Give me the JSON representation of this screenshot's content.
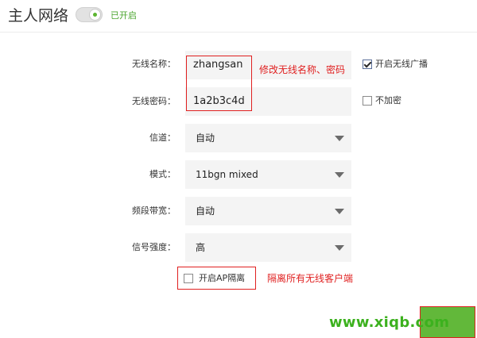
{
  "header": {
    "title": "主人网络",
    "toggle_status": "已开启"
  },
  "wireless": {
    "ssid_label": "无线名称：",
    "ssid_value": "zhangsan",
    "password_label": "无线密码：",
    "password_value": "1a2b3c4d",
    "broadcast_label": "开启无线广播",
    "broadcast_checked": true,
    "no_encrypt_label": "不加密",
    "no_encrypt_checked": false
  },
  "settings": {
    "channel_label": "信道：",
    "channel_value": "自动",
    "mode_label": "模式：",
    "mode_value": "11bgn mixed",
    "bandwidth_label": "频段带宽：",
    "bandwidth_value": "自动",
    "signal_label": "信号强度：",
    "signal_value": "高"
  },
  "ap_isolation": {
    "label": "开启AP隔离",
    "checked": false
  },
  "annotations": {
    "edit_note": "修改无线名称、密码",
    "isolation_note": "隔离所有无线客户端"
  },
  "watermark": "www.xiqb.com",
  "colors": {
    "accent_green": "#5cb531",
    "annotation_red": "#e02020",
    "field_bg": "#f4f4f4"
  }
}
